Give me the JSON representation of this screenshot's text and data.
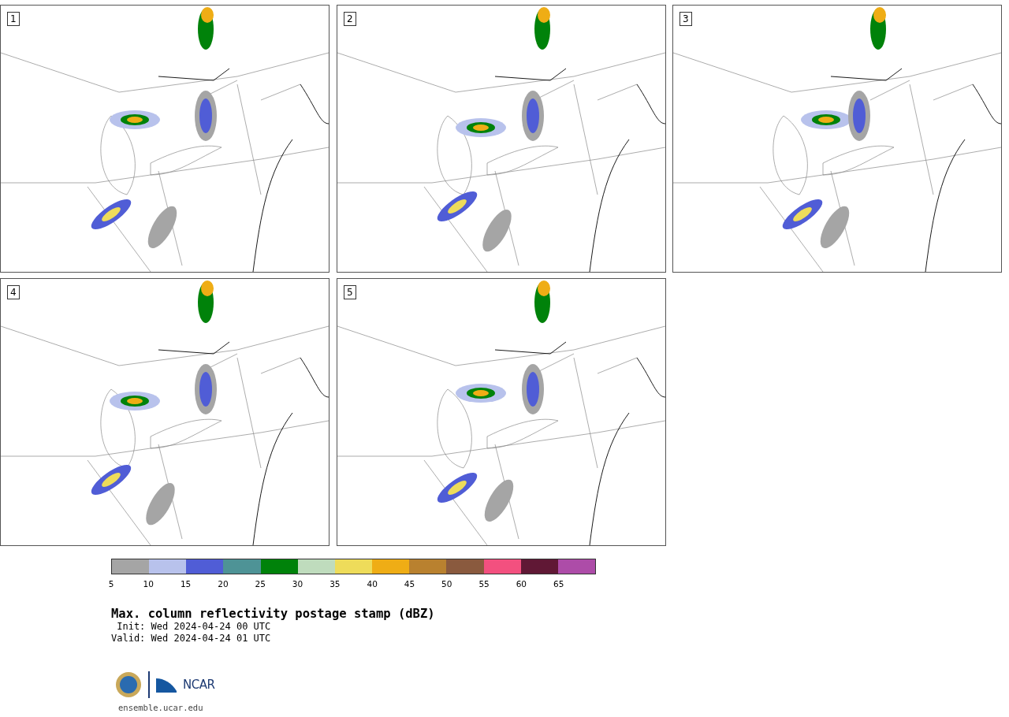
{
  "panels": [
    {
      "label": "1"
    },
    {
      "label": "2"
    },
    {
      "label": "3"
    },
    {
      "label": "4"
    },
    {
      "label": "5"
    }
  ],
  "colorbar": {
    "segments": [
      {
        "color": "#a5a5a5"
      },
      {
        "color": "#b8c2ec"
      },
      {
        "color": "#505dd6"
      },
      {
        "color": "#4e9396"
      },
      {
        "color": "#00820a"
      },
      {
        "color": "#bfdcbd"
      },
      {
        "color": "#eedc5a"
      },
      {
        "color": "#efad15"
      },
      {
        "color": "#b9812f"
      },
      {
        "color": "#8a5a3e"
      },
      {
        "color": "#f3507f"
      },
      {
        "color": "#601835"
      },
      {
        "color": "#ad4ca8"
      }
    ],
    "ticks": [
      "5",
      "10",
      "15",
      "20",
      "25",
      "30",
      "35",
      "40",
      "45",
      "50",
      "55",
      "60",
      "65"
    ]
  },
  "title": "Max. column reflectivity postage stamp (dBZ)",
  "init": " Init: Wed 2024-04-24 00 UTC",
  "valid": "Valid: Wed 2024-04-24 01 UTC",
  "logo": {
    "text": "NCAR"
  },
  "footer": "ensemble.ucar.edu"
}
